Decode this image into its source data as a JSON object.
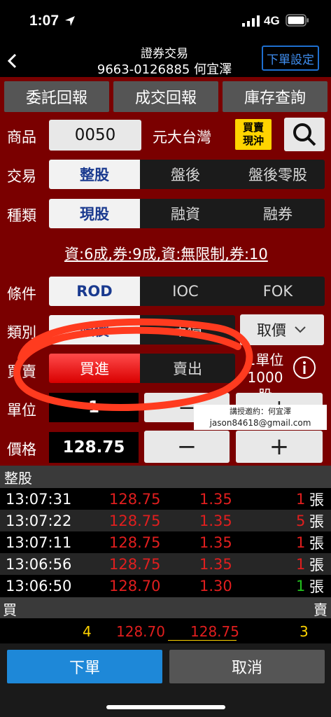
{
  "status": {
    "time": "1:07",
    "network": "4G"
  },
  "header": {
    "title": "證券交易",
    "account": "9663-0126885 何宜澤",
    "settings_label": "下單設定"
  },
  "tabs": [
    {
      "label": "委託回報"
    },
    {
      "label": "成交回報"
    },
    {
      "label": "庫存查詢"
    }
  ],
  "form": {
    "product_label": "商品",
    "product_code": "0050",
    "product_name": "元大台灣",
    "day_trade_badge": "買賣現沖",
    "trade_label": "交易",
    "trade_options": [
      "整股",
      "盤後",
      "盤後零股"
    ],
    "type_label": "種類",
    "type_options": [
      "現股",
      "融資",
      "融券"
    ],
    "margin_info": "資:6成,券:9成,資:無限制,券:10",
    "condition_label": "條件",
    "condition_options": [
      "ROD",
      "IOC",
      "FOK"
    ],
    "category_label": "類別",
    "category_options": [
      "限價",
      "市價"
    ],
    "get_price_label": "取價",
    "side_label": "買賣",
    "side_options": [
      "買進",
      "賣出"
    ],
    "unit_note_1": "1單位",
    "unit_note_2": "1000股",
    "unit_label": "單位",
    "unit_value": "1",
    "price_label": "價格",
    "price_value": "128.75",
    "minus": "−",
    "plus": "+"
  },
  "watermark": {
    "line1": "講授邀約：何宜澤",
    "line2": "jason84618@gmail.com"
  },
  "trades": {
    "section_label": "整股",
    "rows": [
      {
        "time": "13:07:31",
        "price": "128.75",
        "change": "1.35",
        "qty": "1",
        "unit": "張",
        "qty_color": "red"
      },
      {
        "time": "13:07:22",
        "price": "128.75",
        "change": "1.35",
        "qty": "5",
        "unit": "張",
        "qty_color": "red"
      },
      {
        "time": "13:07:11",
        "price": "128.75",
        "change": "1.35",
        "qty": "1",
        "unit": "張",
        "qty_color": "red"
      },
      {
        "time": "13:06:56",
        "price": "128.75",
        "change": "1.35",
        "qty": "1",
        "unit": "張",
        "qty_color": "red"
      },
      {
        "time": "13:06:50",
        "price": "128.70",
        "change": "1.30",
        "qty": "1",
        "unit": "張",
        "qty_color": "green"
      }
    ]
  },
  "book": {
    "buy_label": "買",
    "sell_label": "賣",
    "bid_qty": "4",
    "bid_price": "128.70",
    "ask_price": "128.75",
    "ask_qty": "3"
  },
  "actions": {
    "submit_label": "下單",
    "cancel_label": "取消"
  },
  "colors": {
    "panel": "#7a0000",
    "accent_blue": "#1e88d8",
    "sell_red": "#e01e1e",
    "buy_green": "#22c01d",
    "annotation": "#ff3b1f"
  }
}
